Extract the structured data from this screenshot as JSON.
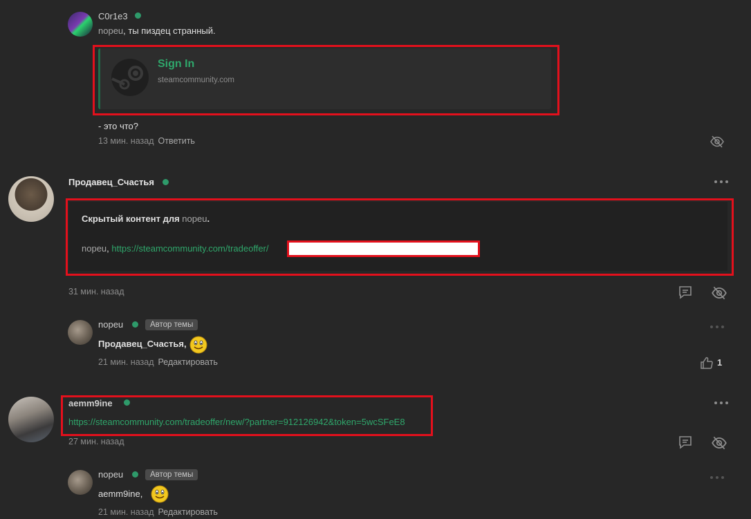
{
  "comments": [
    {
      "author": "C0r1e3",
      "mention": "nopeu",
      "text": ", ты пиздец странный.",
      "embed": {
        "title": "Sign In",
        "domain": "steamcommunity.com"
      },
      "after_text": "- это что?",
      "time": "13 мин. назад",
      "action": "Ответить"
    },
    {
      "author": "Продавец_Счастья",
      "hidden_label": "Скрытый контент для",
      "hidden_target": "nopeu",
      "hidden_dot": ".",
      "mention": "nopeu",
      "link": "https://steamcommunity.com/tradeoffer/",
      "time": "31 мин. назад"
    },
    {
      "author": "nopeu",
      "badge": "Автор темы",
      "reply_to": "Продавец_Счастья",
      "time": "21 мин. назад",
      "action": "Редактировать",
      "likes": "1"
    },
    {
      "author": "aemm9ine",
      "link": "https://steamcommunity.com/tradeoffer/new/?partner=912126942&token=5wcSFeE8",
      "time": "27 мин. назад"
    },
    {
      "author": "nopeu",
      "badge": "Автор темы",
      "reply_to": "aemm9ine",
      "time": "21 мин. назад",
      "action": "Редактировать"
    }
  ],
  "colors": {
    "background": "#272727",
    "online": "#2e9a6a",
    "link": "#2fa76b",
    "highlight": "#e3101c"
  },
  "icons": [
    "hide-icon",
    "reply-icon",
    "like-icon",
    "more-icon",
    "smiley-icon",
    "steam-icon"
  ]
}
